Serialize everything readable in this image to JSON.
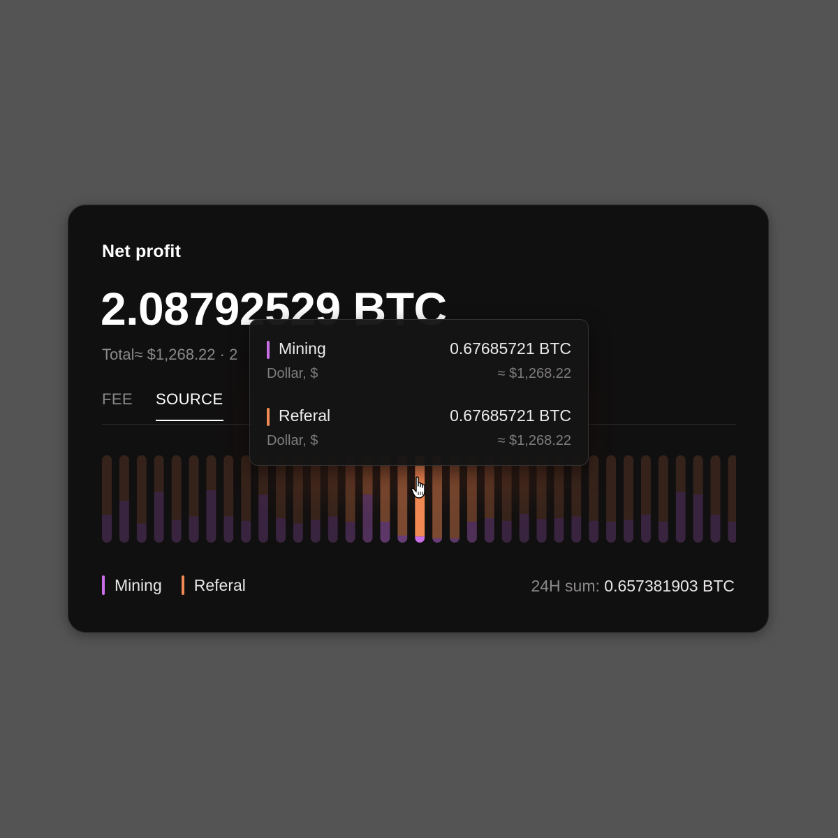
{
  "card": {
    "title": "Net profit",
    "amount": "2.08792529 BTC",
    "subline": "Total≈ $1,268.22 · 2"
  },
  "tabs": [
    {
      "label": "FEE",
      "active": false
    },
    {
      "label": "SOURCE",
      "active": true
    }
  ],
  "colors": {
    "mining": "#c86fe6",
    "referal": "#f08a55",
    "card_bg": "#111010",
    "page_bg": "#545454"
  },
  "chart_data": {
    "type": "bar",
    "stacked": true,
    "series": [
      {
        "name": "Mining",
        "values": [
          0.32,
          0.48,
          0.22,
          0.58,
          0.26,
          0.3,
          0.6,
          0.3,
          0.25,
          0.55,
          0.28,
          0.22,
          0.26,
          0.3,
          0.24,
          0.55,
          0.24,
          0.08,
          0.07,
          0.05,
          0.05,
          0.24,
          0.28,
          0.25,
          0.33,
          0.27,
          0.28,
          0.3,
          0.25,
          0.24,
          0.26,
          0.32,
          0.24,
          0.58,
          0.55,
          0.32,
          0.24,
          0.4,
          0.32,
          0.55,
          0.24,
          0.58,
          0.4,
          0.32
        ]
      },
      {
        "name": "Referal",
        "values": [
          0.68,
          0.52,
          0.78,
          0.42,
          0.74,
          0.7,
          0.4,
          0.7,
          0.75,
          0.45,
          0.72,
          0.78,
          0.74,
          0.7,
          0.76,
          0.45,
          0.76,
          0.92,
          0.93,
          0.95,
          0.95,
          0.76,
          0.72,
          0.75,
          0.67,
          0.73,
          0.72,
          0.7,
          0.75,
          0.76,
          0.74,
          0.68,
          0.76,
          0.42,
          0.45,
          0.68,
          0.76,
          0.6,
          0.68,
          0.45,
          0.76,
          0.42,
          0.6,
          0.68
        ]
      }
    ],
    "highlighted_index": 18
  },
  "legend": [
    {
      "label": "Mining",
      "key": "mining"
    },
    {
      "label": "Referal",
      "key": "referal"
    }
  ],
  "summary": {
    "label": "24H sum:",
    "value": "0.657381903 BTC"
  },
  "tooltip": {
    "rows": [
      {
        "name": "Mining",
        "btc": "0.67685721 BTC",
        "unit": "Dollar, $",
        "usd": "≈ $1,268.22"
      },
      {
        "name": "Referal",
        "btc": "0.67685721 BTC",
        "unit": "Dollar, $",
        "usd": "≈ $1,268.22"
      }
    ]
  },
  "icons": {
    "cursor": "hand-pointer-icon"
  }
}
